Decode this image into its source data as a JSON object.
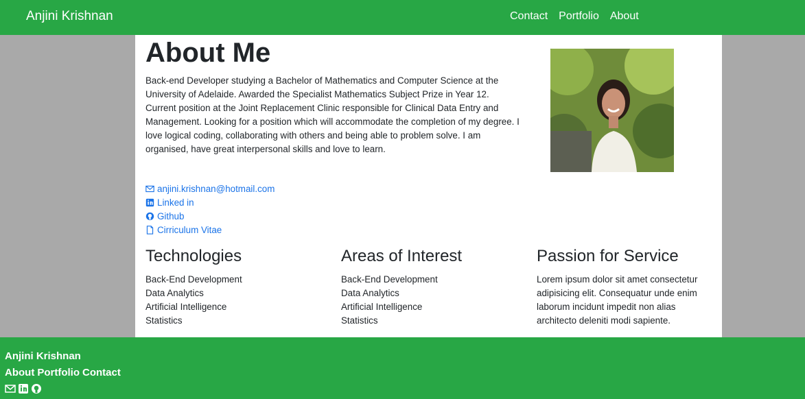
{
  "nav": {
    "brand": "Anjini Krishnan",
    "links": [
      "Contact",
      "Portfolio",
      "About"
    ]
  },
  "about": {
    "title": "About Me",
    "bio": "Back-end Developer studying a Bachelor of Mathematics and Computer Science at the University of Adelaide. Awarded the Specialist Mathematics Subject Prize in Year 12. Current position at the Joint Replacement Clinic responsible for Clinical Data Entry and Management. Looking for a position which will accommodate the completion of my degree. I love logical coding, collaborating with others and being able to problem solve. I am organised, have great interpersonal skills and love to learn."
  },
  "contacts": [
    {
      "label": "anjini.krishnan@hotmail.com",
      "icon": "envelope-icon"
    },
    {
      "label": "Linked in",
      "icon": "linkedin-icon"
    },
    {
      "label": "Github",
      "icon": "github-icon"
    },
    {
      "label": "Cirriculum Vitae",
      "icon": "file-icon"
    }
  ],
  "columns": [
    {
      "heading": "Technologies",
      "items": [
        "Back-End Development",
        "Data Analytics",
        "Artificial Intelligence",
        "Statistics"
      ]
    },
    {
      "heading": "Areas of Interest",
      "items": [
        "Back-End Development",
        "Data Analytics",
        "Artificial Intelligence",
        "Statistics"
      ]
    },
    {
      "heading": "Passion for Service",
      "text": "Lorem ipsum dolor sit amet consectetur adipisicing elit. Consequatur unde enim laborum incidunt impedit non alias architecto deleniti modi sapiente."
    }
  ],
  "footer": {
    "name": "Anjini Krishnan",
    "links": [
      "About",
      "Portfolio",
      "Contact"
    ],
    "icons": [
      "envelope-icon",
      "linkedin-icon",
      "github-icon"
    ]
  },
  "colors": {
    "accent": "#28a745",
    "link": "#1a73e8",
    "background": "#a9a9a9"
  }
}
